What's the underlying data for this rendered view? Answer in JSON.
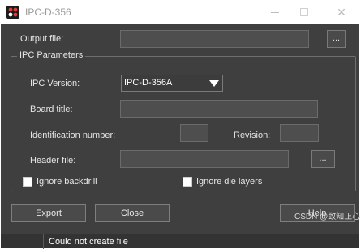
{
  "window": {
    "title": "IPC-D-356",
    "minimize_icon": "minimize-icon",
    "maximize_icon": "maximize-icon",
    "close_glyph": "✕"
  },
  "output": {
    "label": "Output file:",
    "value": "",
    "browse_label": "..."
  },
  "ipc_parameters": {
    "group_title": "IPC Parameters",
    "version_label": "IPC Version:",
    "version_value": "IPC-D-356A",
    "board_title_label": "Board title:",
    "board_title_value": "",
    "identification_label": "Identification number:",
    "identification_value": "",
    "revision_label": "Revision:",
    "revision_value": "",
    "header_file_label": "Header file:",
    "header_file_value": "",
    "header_browse_label": "..."
  },
  "options": {
    "ignore_backdrill_label": "Ignore backdrill",
    "ignore_backdrill_checked": false,
    "ignore_die_layers_label": "Ignore die layers",
    "ignore_die_layers_checked": false
  },
  "buttons": {
    "export": "Export",
    "close": "Close",
    "help": "Help"
  },
  "status": {
    "message": "Could not create file"
  },
  "watermark": "CSDN @致知正心",
  "colors": {
    "panel_background": "#3f3f3f",
    "field_background": "#4e4e4e",
    "text": "#e6e6e6"
  }
}
